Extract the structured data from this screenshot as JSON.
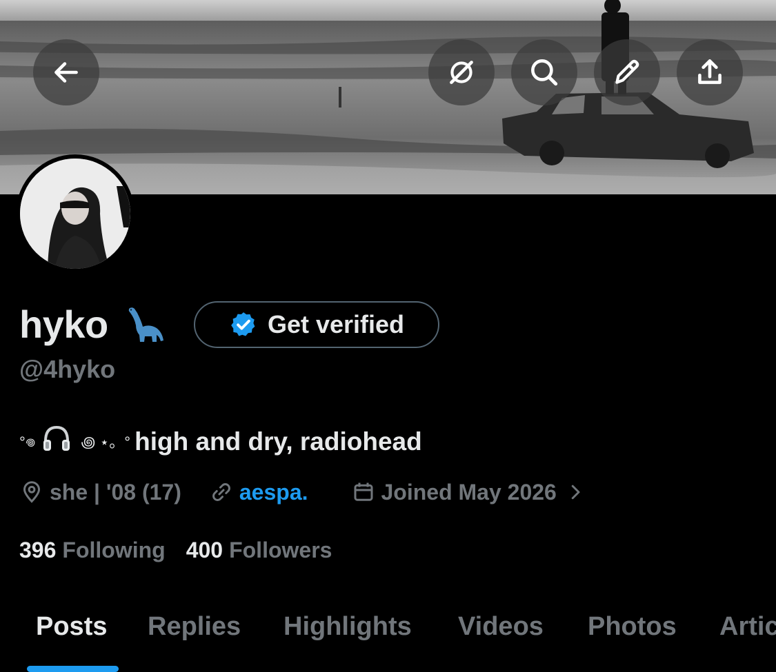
{
  "header": {
    "back_icon": "arrow-left-icon",
    "action_icons": [
      "grok-icon",
      "search-icon",
      "pencil-icon",
      "share-icon"
    ]
  },
  "profile": {
    "display_name": "hyko",
    "emoji": "sauropod-dinosaur",
    "handle": "@4hyko",
    "get_verified_label": "Get verified",
    "bio_prefix": "°𖦹",
    "bio_suffix": "꩜ ⋆。°",
    "bio_text": "high and dry, radiohead",
    "location": "she | '08 (17)",
    "link": "aespa.",
    "joined": "Joined May 2026",
    "following_count": "396",
    "following_label": "Following",
    "followers_count": "400",
    "followers_label": "Followers"
  },
  "tabs": [
    "Posts",
    "Replies",
    "Highlights",
    "Videos",
    "Photos",
    "Artic"
  ],
  "active_tab": "Posts",
  "colors": {
    "background": "#000000",
    "text": "#e7e9ea",
    "muted": "#71767b",
    "accent": "#1d9bf0"
  }
}
